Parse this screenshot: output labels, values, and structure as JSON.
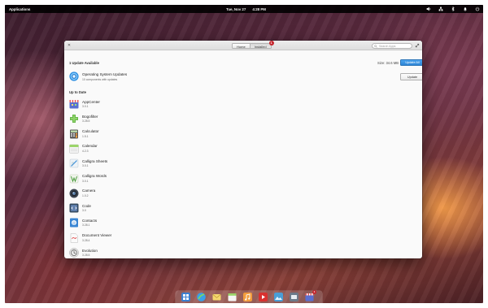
{
  "panel": {
    "applications_label": "Applications",
    "date": "Tue, Nov 27",
    "time": "4:28 PM",
    "tray_icons": [
      "volume-icon",
      "network-icon",
      "bluetooth-icon",
      "notifications-icon",
      "power-icon"
    ]
  },
  "window": {
    "tabs": [
      {
        "label": "Home"
      },
      {
        "label": "Installed",
        "badge": "1"
      }
    ],
    "search_placeholder": "Search Apps",
    "updates_heading": "1 Update Available",
    "size_text": "Size: 34.6 MB",
    "update_all_label": "Update All",
    "os_update": {
      "title": "Operating System Updates",
      "subtitle": "10 components with updates",
      "button_label": "Update"
    },
    "up_to_date_heading": "Up to Date",
    "apps": [
      {
        "name": "AppCenter",
        "version": "3.0.1",
        "icon": "appcenter-icon"
      },
      {
        "name": "Bogofilter",
        "version": "3.28.5",
        "icon": "bogofilter-icon"
      },
      {
        "name": "Calculator",
        "version": "1.5.1",
        "icon": "calculator-icon"
      },
      {
        "name": "Calendar",
        "version": "4.2.3",
        "icon": "calendar-icon"
      },
      {
        "name": "Calligra Sheets",
        "version": "3.0.1",
        "icon": "calligra-sheets-icon"
      },
      {
        "name": "Calligra Words",
        "version": "3.0.1",
        "icon": "calligra-words-icon"
      },
      {
        "name": "Camera",
        "version": "1.0.2",
        "icon": "camera-icon"
      },
      {
        "name": "Code",
        "version": "3.0",
        "icon": "code-icon"
      },
      {
        "name": "Contacts",
        "version": "3.28.1",
        "icon": "contacts-icon"
      },
      {
        "name": "Document Viewer",
        "version": "3.28.4",
        "icon": "document-viewer-icon"
      },
      {
        "name": "Evolution",
        "version": "3.28.5",
        "icon": "evolution-icon"
      }
    ]
  },
  "dock": {
    "items": [
      "multitasking-view-icon",
      "web-browser-icon",
      "mail-icon",
      "calendar-icon",
      "music-icon",
      "videos-icon",
      "photos-icon",
      "switchboard-icon",
      "appcenter-icon"
    ],
    "appcenter_badge": "1"
  },
  "colors": {
    "accent": "#3689e6",
    "badge": "#c6262e"
  }
}
